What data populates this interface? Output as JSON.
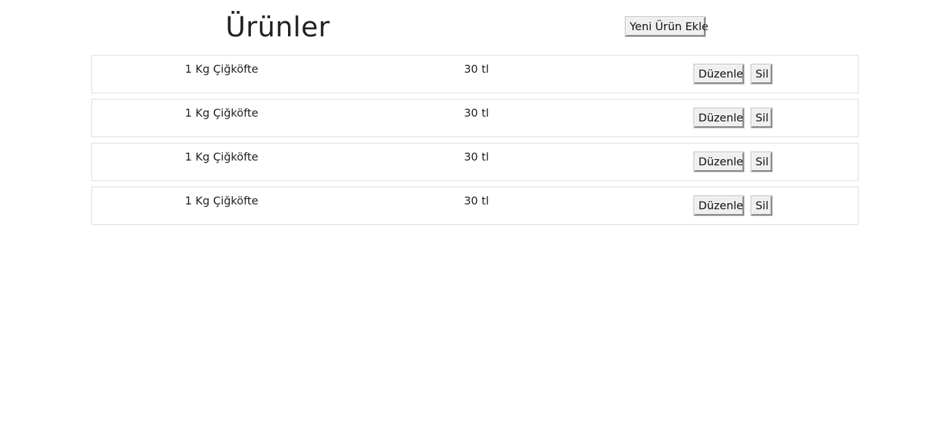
{
  "header": {
    "title": "Ürünler",
    "add_button_label": "Yeni Ürün Ekle"
  },
  "products": [
    {
      "name": "1 Kg Çiğköfte",
      "price": "30 tl",
      "edit_label": "Düzenle",
      "delete_label": "Sil"
    },
    {
      "name": "1 Kg Çiğköfte",
      "price": "30 tl",
      "edit_label": "Düzenle",
      "delete_label": "Sil"
    },
    {
      "name": "1 Kg Çiğköfte",
      "price": "30 tl",
      "edit_label": "Düzenle",
      "delete_label": "Sil"
    },
    {
      "name": "1 Kg Çiğköfte",
      "price": "30 tl",
      "edit_label": "Düzenle",
      "delete_label": "Sil"
    }
  ]
}
